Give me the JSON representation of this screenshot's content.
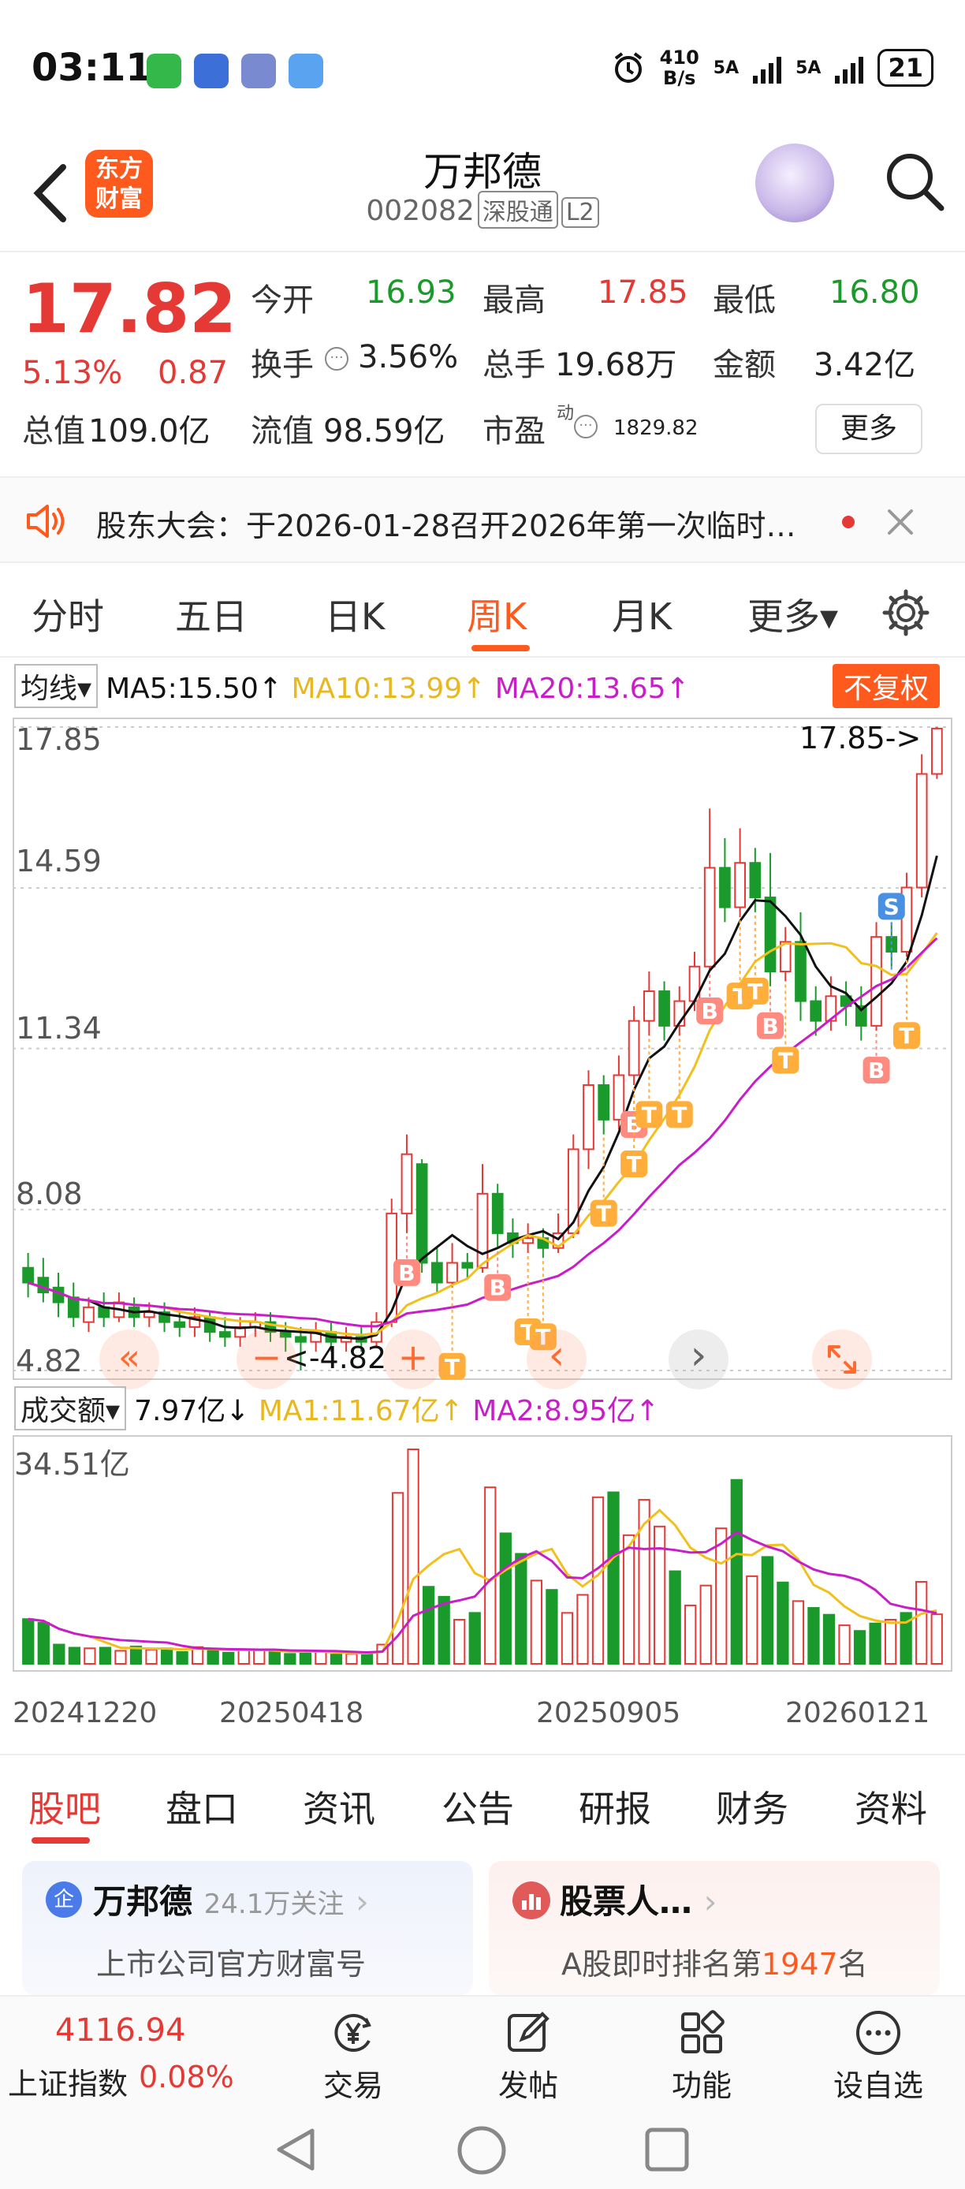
{
  "status_bar": {
    "time": "03:11",
    "net_speed_top": "410",
    "net_speed_bottom": "B/s",
    "sim1": "5A",
    "sim2": "5A",
    "battery": "21"
  },
  "header": {
    "logo_text_1": "东方",
    "logo_text_2": "财富",
    "stock_name": "万邦德",
    "stock_code": "002082",
    "tag_connect": "深股通",
    "tag_level": "L2"
  },
  "quote": {
    "price": "17.82",
    "change_pct": "5.13%",
    "change": "0.87",
    "open_label": "今开",
    "open": "16.93",
    "high_label": "最高",
    "high": "17.85",
    "low_label": "最低",
    "low": "16.80",
    "turnover_label": "换手",
    "turnover": "3.56%",
    "volume_label": "总手",
    "volume": "19.68万",
    "amount_label": "金额",
    "amount": "3.42亿",
    "mktcap_label": "总值",
    "mktcap": "109.0亿",
    "float_label": "流值",
    "float": "98.59亿",
    "pe_label": "市盈",
    "pe_sup": "动",
    "pe": "1829.82",
    "more_label": "更多"
  },
  "notice": {
    "text": "股东大会：于2026-01-28召开2026年第一次临时…"
  },
  "period_tabs": [
    {
      "label": "分时"
    },
    {
      "label": "五日"
    },
    {
      "label": "日K"
    },
    {
      "label": "周K"
    },
    {
      "label": "月K"
    },
    {
      "label": "更多▾"
    }
  ],
  "chart_header": {
    "ma_select": "均线▾",
    "ma5": "MA5:15.50↑",
    "ma10": "MA10:13.99↑",
    "ma20": "MA20:13.65↑",
    "fuquan": "不复权",
    "vol_select": "成交额▾",
    "vol_now": "7.97亿↓",
    "vol_ma1": "MA1:11.67亿↑",
    "vol_ma2": "MA2:8.95亿↑"
  },
  "colors": {
    "up": "#e53935",
    "down": "#1a9a2a",
    "ma5": "#111111",
    "ma10": "#f2c01e",
    "ma20": "#c81ec8",
    "accent": "#ff5a1e"
  },
  "chart_data": [
    {
      "type": "candlestick",
      "title": "周K",
      "y_ticks": [
        "17.85",
        "14.59",
        "11.34",
        "8.08",
        "4.82"
      ],
      "ylim": [
        4.82,
        17.85
      ],
      "max_marker": "17.85->",
      "min_marker": "<-4.82",
      "x_ticks": [
        "20241220",
        "20250418",
        "20250905",
        "20260121"
      ],
      "candles": [
        {
          "o": 6.9,
          "c": 6.6,
          "h": 7.2,
          "l": 6.3
        },
        {
          "o": 6.7,
          "c": 6.4,
          "h": 7.1,
          "l": 6.2
        },
        {
          "o": 6.5,
          "c": 6.2,
          "h": 6.8,
          "l": 5.9
        },
        {
          "o": 6.3,
          "c": 5.9,
          "h": 6.6,
          "l": 5.7
        },
        {
          "o": 5.8,
          "c": 6.1,
          "h": 6.3,
          "l": 5.6
        },
        {
          "o": 6.1,
          "c": 5.9,
          "h": 6.4,
          "l": 5.7
        },
        {
          "o": 5.9,
          "c": 6.2,
          "h": 6.4,
          "l": 5.8
        },
        {
          "o": 6.1,
          "c": 5.9,
          "h": 6.3,
          "l": 5.7
        },
        {
          "o": 5.9,
          "c": 6.0,
          "h": 6.2,
          "l": 5.7
        },
        {
          "o": 6.0,
          "c": 5.8,
          "h": 6.2,
          "l": 5.6
        },
        {
          "o": 5.8,
          "c": 5.7,
          "h": 6.0,
          "l": 5.5
        },
        {
          "o": 5.7,
          "c": 5.9,
          "h": 6.1,
          "l": 5.5
        },
        {
          "o": 5.9,
          "c": 5.6,
          "h": 6.0,
          "l": 5.4
        },
        {
          "o": 5.6,
          "c": 5.5,
          "h": 5.9,
          "l": 5.3
        },
        {
          "o": 5.5,
          "c": 5.7,
          "h": 5.9,
          "l": 5.3
        },
        {
          "o": 5.7,
          "c": 5.8,
          "h": 6.0,
          "l": 5.5
        },
        {
          "o": 5.8,
          "c": 5.6,
          "h": 6.0,
          "l": 5.4
        },
        {
          "o": 5.6,
          "c": 5.5,
          "h": 5.8,
          "l": 5.2
        },
        {
          "o": 5.5,
          "c": 5.4,
          "h": 5.7,
          "l": 4.82
        },
        {
          "o": 5.4,
          "c": 5.6,
          "h": 5.8,
          "l": 5.2
        },
        {
          "o": 5.6,
          "c": 5.4,
          "h": 5.8,
          "l": 5.2
        },
        {
          "o": 5.4,
          "c": 5.5,
          "h": 5.7,
          "l": 5.2
        },
        {
          "o": 5.5,
          "c": 5.4,
          "h": 5.7,
          "l": 5.2
        },
        {
          "o": 5.4,
          "c": 5.8,
          "h": 6.0,
          "l": 5.3
        },
        {
          "o": 5.8,
          "c": 8.0,
          "h": 8.3,
          "l": 5.7
        },
        {
          "o": 8.0,
          "c": 9.2,
          "h": 9.6,
          "l": 7.6
        },
        {
          "o": 9.0,
          "c": 7.0,
          "h": 9.1,
          "l": 6.8
        },
        {
          "o": 7.0,
          "c": 6.6,
          "h": 7.3,
          "l": 6.4
        },
        {
          "o": 6.6,
          "c": 7.0,
          "h": 7.4,
          "l": 6.5
        },
        {
          "o": 7.0,
          "c": 6.9,
          "h": 7.2,
          "l": 6.7
        },
        {
          "o": 6.9,
          "c": 8.4,
          "h": 9.0,
          "l": 6.8
        },
        {
          "o": 8.4,
          "c": 7.6,
          "h": 8.6,
          "l": 7.3
        },
        {
          "o": 7.6,
          "c": 7.4,
          "h": 7.9,
          "l": 7.1
        },
        {
          "o": 7.4,
          "c": 7.5,
          "h": 7.8,
          "l": 7.2
        },
        {
          "o": 7.5,
          "c": 7.3,
          "h": 7.7,
          "l": 7.1
        },
        {
          "o": 7.3,
          "c": 7.6,
          "h": 8.0,
          "l": 7.2
        },
        {
          "o": 7.6,
          "c": 9.3,
          "h": 9.6,
          "l": 7.5
        },
        {
          "o": 9.3,
          "c": 10.6,
          "h": 10.9,
          "l": 8.9
        },
        {
          "o": 10.6,
          "c": 9.9,
          "h": 10.8,
          "l": 9.6
        },
        {
          "o": 9.9,
          "c": 10.8,
          "h": 11.2,
          "l": 9.7
        },
        {
          "o": 10.8,
          "c": 11.9,
          "h": 12.2,
          "l": 10.6
        },
        {
          "o": 11.9,
          "c": 12.5,
          "h": 12.9,
          "l": 11.6
        },
        {
          "o": 12.5,
          "c": 11.8,
          "h": 12.7,
          "l": 11.5
        },
        {
          "o": 11.8,
          "c": 12.3,
          "h": 12.6,
          "l": 11.6
        },
        {
          "o": 12.3,
          "c": 13.0,
          "h": 13.3,
          "l": 12.1
        },
        {
          "o": 13.0,
          "c": 15.0,
          "h": 16.2,
          "l": 12.9
        },
        {
          "o": 15.0,
          "c": 14.2,
          "h": 15.6,
          "l": 13.9
        },
        {
          "o": 14.2,
          "c": 15.1,
          "h": 15.8,
          "l": 14.0
        },
        {
          "o": 15.1,
          "c": 14.4,
          "h": 15.4,
          "l": 14.1
        },
        {
          "o": 14.4,
          "c": 12.9,
          "h": 15.3,
          "l": 12.6
        },
        {
          "o": 12.9,
          "c": 13.5,
          "h": 13.8,
          "l": 12.7
        },
        {
          "o": 13.5,
          "c": 12.3,
          "h": 14.1,
          "l": 11.9
        },
        {
          "o": 12.3,
          "c": 11.9,
          "h": 12.6,
          "l": 11.6
        },
        {
          "o": 11.9,
          "c": 12.4,
          "h": 12.8,
          "l": 11.7
        },
        {
          "o": 12.4,
          "c": 12.2,
          "h": 12.7,
          "l": 11.8
        },
        {
          "o": 12.2,
          "c": 11.8,
          "h": 12.6,
          "l": 11.5
        },
        {
          "o": 11.8,
          "c": 13.6,
          "h": 13.9,
          "l": 11.7
        },
        {
          "o": 13.6,
          "c": 13.3,
          "h": 13.9,
          "l": 13.0
        },
        {
          "o": 13.3,
          "c": 14.6,
          "h": 14.9,
          "l": 13.2
        },
        {
          "o": 14.6,
          "c": 16.9,
          "h": 17.3,
          "l": 14.4
        },
        {
          "o": 16.9,
          "c": 17.82,
          "h": 17.85,
          "l": 16.8
        }
      ],
      "markers": [
        {
          "label": "B",
          "i": 25
        },
        {
          "label": "B",
          "i": 31
        },
        {
          "label": "T",
          "i": 28
        },
        {
          "label": "T",
          "i": 33
        },
        {
          "label": "T",
          "i": 34
        },
        {
          "label": "T",
          "i": 38
        },
        {
          "label": "B",
          "i": 40
        },
        {
          "label": "T",
          "i": 40
        },
        {
          "label": "T",
          "i": 41
        },
        {
          "label": "T",
          "i": 43
        },
        {
          "label": "B",
          "i": 45
        },
        {
          "label": "T",
          "i": 47
        },
        {
          "label": "B",
          "i": 49
        },
        {
          "label": "T",
          "i": 48
        },
        {
          "label": "T",
          "i": 50
        },
        {
          "label": "B",
          "i": 56
        },
        {
          "label": "T",
          "i": 58
        },
        {
          "label": "S",
          "i": 57
        }
      ]
    },
    {
      "type": "bar",
      "title": "成交额",
      "y_ticks": [
        "34.51亿"
      ],
      "ylim": [
        0,
        34.51
      ],
      "values": [
        7.2,
        6.6,
        3.1,
        2.6,
        2.5,
        2.6,
        2.1,
        2.8,
        2.3,
        2.5,
        1.9,
        2.7,
        2.4,
        1.8,
        2.2,
        2.2,
        2.0,
        1.6,
        1.9,
        2.1,
        1.5,
        1.6,
        1.5,
        3.1,
        27.5,
        34.51,
        12.4,
        10.8,
        7.1,
        8.2,
        28.4,
        21.0,
        17.7,
        13.4,
        11.9,
        8.2,
        11.1,
        26.8,
        27.6,
        20.7,
        26.4,
        22.1,
        14.9,
        9.4,
        12.6,
        21.8,
        29.6,
        14.1,
        17.2,
        13.1,
        10.1,
        9.0,
        7.9,
        6.2,
        5.3,
        6.5,
        7.1,
        8.2,
        13.2,
        7.97
      ]
    }
  ],
  "chart_controls": {
    "prev": "«",
    "zoom_out": "−",
    "zoom_in": "+",
    "left": "‹",
    "right": "›"
  },
  "bottom_tabs": [
    {
      "label": "股吧"
    },
    {
      "label": "盘口"
    },
    {
      "label": "资讯"
    },
    {
      "label": "公告"
    },
    {
      "label": "研报"
    },
    {
      "label": "财务"
    },
    {
      "label": "资料"
    }
  ],
  "cards": {
    "left": {
      "icon": "企",
      "title": "万邦德",
      "follow": "24.1万关注",
      "subtitle": "上市公司官方财富号"
    },
    "right": {
      "title": "股票人…",
      "subtitle_prefix": "A股即时排名第",
      "rank": "1947",
      "subtitle_suffix": "名"
    }
  },
  "bottom_bar": {
    "index_value": "4116.94",
    "index_name": "上证指数",
    "index_pct": "0.08%",
    "nav": [
      {
        "label": "交易"
      },
      {
        "label": "发帖"
      },
      {
        "label": "功能"
      },
      {
        "label": "设自选"
      }
    ]
  }
}
